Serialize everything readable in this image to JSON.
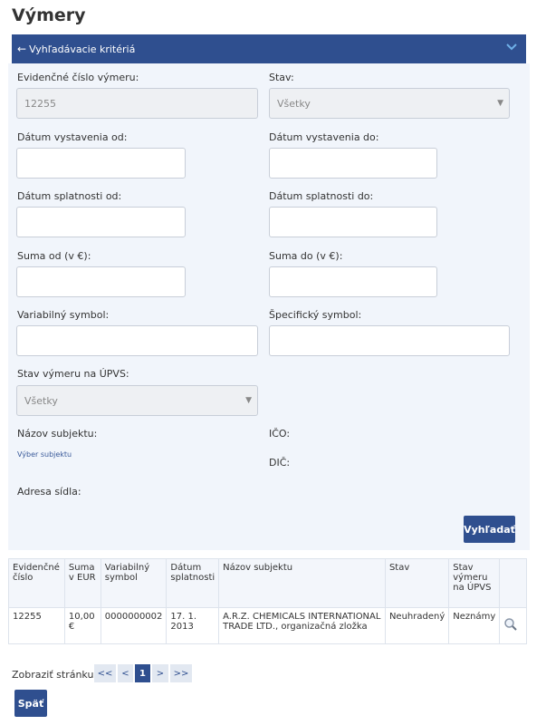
{
  "page": {
    "title": "Výmery"
  },
  "panel": {
    "title": "Vyhľadávacie kritériá"
  },
  "form": {
    "evid_label": "Evidenčné číslo výmeru:",
    "evid_value": "12255",
    "stav_label": "Stav:",
    "stav_value": "Všetky",
    "datum_vyst_od_label": "Dátum vystavenia od:",
    "datum_vyst_do_label": "Dátum vystavenia do:",
    "datum_spl_od_label": "Dátum splatnosti od:",
    "datum_spl_do_label": "Dátum splatnosti do:",
    "suma_od_label": "Suma od (v €):",
    "suma_do_label": "Suma do (v €):",
    "var_symbol_label": "Variabilný symbol:",
    "spec_symbol_label": "Špecifický symbol:",
    "stav_upvs_label": "Stav výmeru na ÚPVS:",
    "stav_upvs_value": "Všetky",
    "nazov_subjektu_label": "Názov subjektu:",
    "vyber_subjektu_link": "Výber subjektu",
    "ico_label": "IČO:",
    "dic_label": "DIČ:",
    "adresa_label": "Adresa sídla:",
    "search_button": "Vyhľadať"
  },
  "table": {
    "headers": [
      "Evidenčné číslo",
      "Suma v EUR",
      "Variabilný symbol",
      "Dátum splatnosti",
      "Názov subjektu",
      "Stav",
      "Stav výmeru na ÚPVS",
      ""
    ],
    "rows": [
      [
        "12255",
        "10,00 €",
        "0000000002",
        "17. 1. 2013",
        "A.R.Z. CHEMICALS INTERNATIONAL TRADE LTD., organizačná zložka",
        "Neuhradený",
        "Neznámy",
        ""
      ]
    ]
  },
  "pager": {
    "label": "Zobraziť stránku:",
    "first": "<<",
    "prev": "<",
    "current": "1",
    "next": ">",
    "last": ">>"
  },
  "back_button": "Späť"
}
